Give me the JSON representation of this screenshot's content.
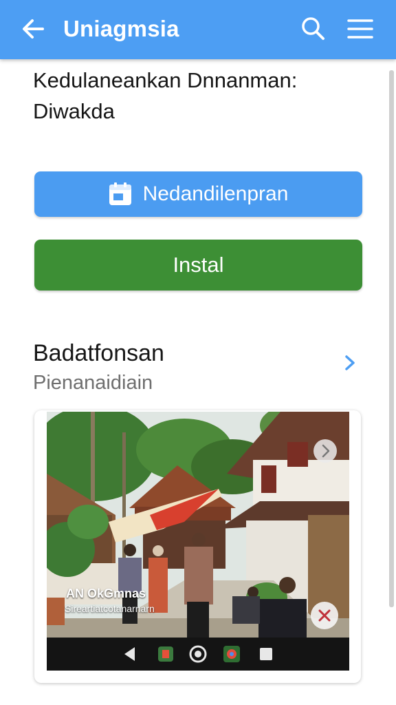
{
  "app_bar": {
    "title": "Uniagmsia",
    "icons": [
      "arrow-back-icon",
      "search-icon",
      "menu-icon"
    ],
    "color": "#4d9ef3"
  },
  "headline": {
    "line1": "Kedulaneankan Dnnanman:",
    "line2": "Diwakda"
  },
  "buttons": {
    "primary_label": "Nedandilenpran",
    "primary_icon": "calendar-icon",
    "primary_color": "#4b9cf1",
    "install_label": "Instal",
    "install_color": "#3d8f35"
  },
  "section": {
    "title": "Badatfonsan",
    "subtitle": "Pienanaidiain",
    "chevron_icon": "chevron-right-icon"
  },
  "media_card": {
    "caption_title": "AN OkGmnas",
    "caption_subtitle": "Sireartiatcotanarnarn",
    "next_icon": "chevron-right-icon",
    "close_icon": "close-icon",
    "nav_icons": [
      "back-triangle-icon",
      "app-icon",
      "home-circle-icon",
      "browser-icon",
      "recents-square-icon"
    ]
  }
}
